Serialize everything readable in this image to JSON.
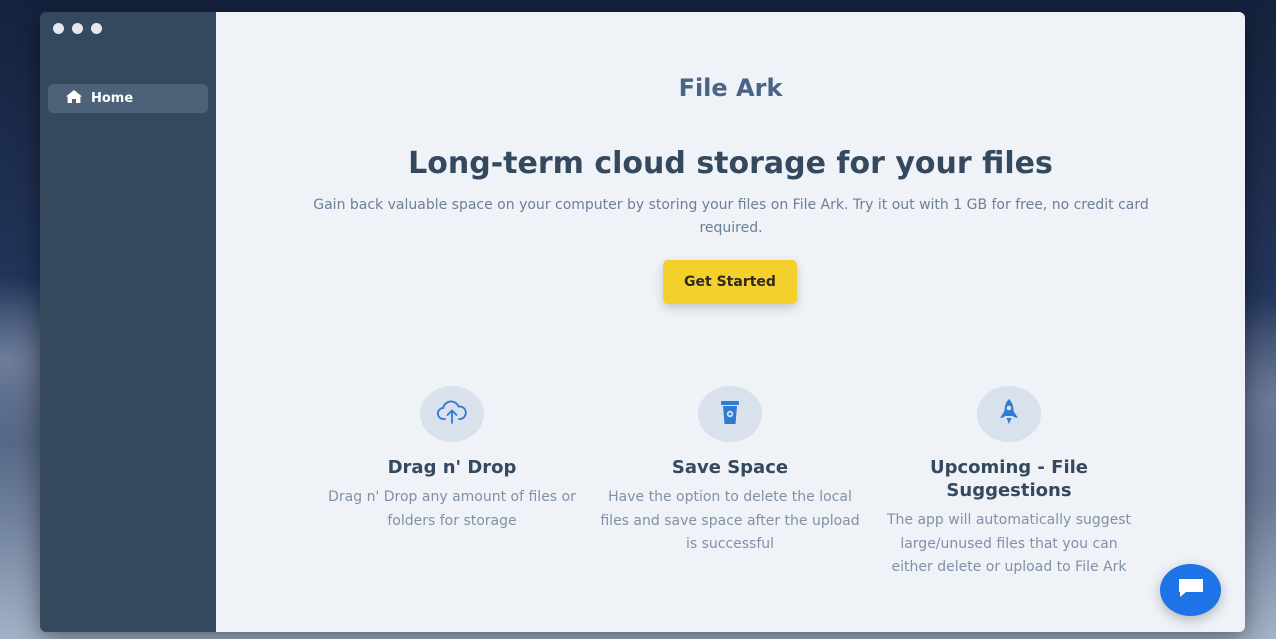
{
  "window": {
    "traffic_lights": [
      "close",
      "minimize",
      "zoom"
    ]
  },
  "sidebar": {
    "items": [
      {
        "label": "Home",
        "icon": "home-icon",
        "active": true
      }
    ]
  },
  "main": {
    "app_title": "File Ark",
    "headline": "Long-term cloud storage for your files",
    "subtitle": "Gain back valuable space on your computer by storing your files on File Ark. Try it out with 1 GB for free, no credit card required.",
    "cta_label": "Get Started",
    "features": [
      {
        "icon": "cloud-upload-icon",
        "title": "Drag n' Drop",
        "description": "Drag n' Drop any amount of files or folders for storage"
      },
      {
        "icon": "trash-bin-icon",
        "title": "Save Space",
        "description": "Have the option to delete the local files and save space after the upload is successful"
      },
      {
        "icon": "rocket-icon",
        "title": "Upcoming - File Suggestions",
        "description": "The app will automatically suggest large/unused files that you can either delete or upload to File Ark"
      }
    ]
  },
  "colors": {
    "sidebar_bg": "#34495e",
    "main_bg": "#eff2f7",
    "accent_yellow": "#f4d02c",
    "chat_blue": "#1e74e6",
    "icon_blue": "#2f7ad6"
  },
  "chat_widget": {
    "icon": "chat-bubble-icon"
  }
}
